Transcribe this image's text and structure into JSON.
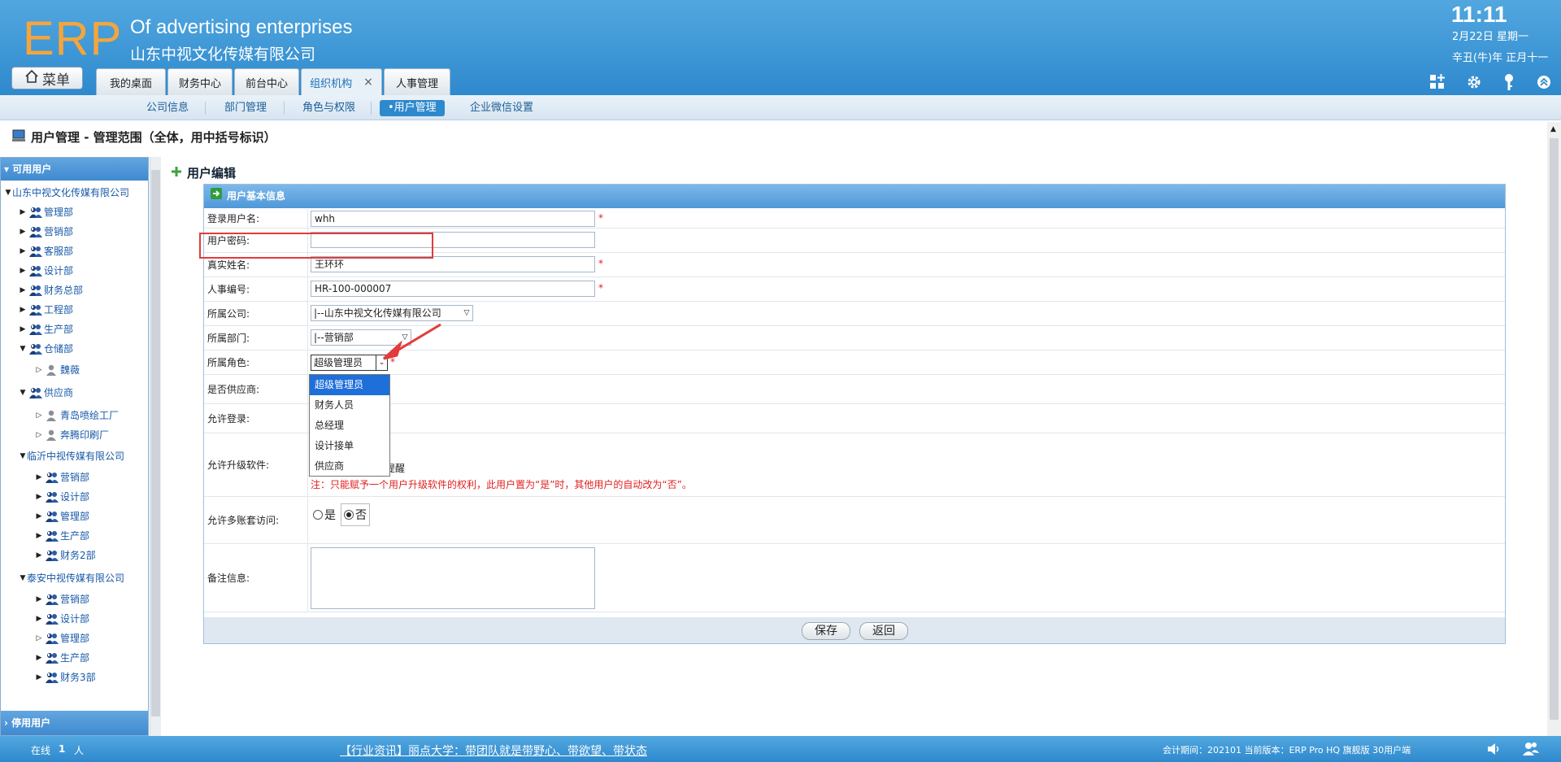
{
  "header": {
    "logo": "ERP",
    "brand_en": "Of advertising enterprises",
    "brand_cn": "山东中视文化传媒有限公司",
    "time": "11:11",
    "date1": "2月22日 星期一",
    "date2": "辛丑(牛)年 正月十一",
    "menu_label": "菜单",
    "tabs": [
      {
        "label": "我的桌面"
      },
      {
        "label": "财务中心"
      },
      {
        "label": "前台中心"
      },
      {
        "label": "组织机构"
      },
      {
        "label": "人事管理"
      }
    ],
    "tab_close": "×"
  },
  "subnav": {
    "items": [
      "公司信息",
      "部门管理",
      "角色与权限",
      "•用户管理",
      "企业微信设置"
    ]
  },
  "page_title": "用户管理 - 管理范围（全体，用中括号标识）",
  "sidebar": {
    "header": "可用用户",
    "footer": "停用用户",
    "tree": [
      {
        "label": "山东中视文化传媒有限公司"
      },
      {
        "label": "管理部"
      },
      {
        "label": "营销部"
      },
      {
        "label": "客服部"
      },
      {
        "label": "设计部"
      },
      {
        "label": "财务总部"
      },
      {
        "label": "工程部"
      },
      {
        "label": "生产部"
      },
      {
        "label": "仓储部"
      },
      {
        "label": "魏薇"
      },
      {
        "label": "供应商"
      },
      {
        "label": "青岛喷绘工厂"
      },
      {
        "label": "奔腾印刷厂"
      },
      {
        "label": "临沂中视传媒有限公司"
      },
      {
        "label": "营销部"
      },
      {
        "label": "设计部"
      },
      {
        "label": "管理部"
      },
      {
        "label": "生产部"
      },
      {
        "label": "财务2部"
      },
      {
        "label": "泰安中视传媒有限公司"
      },
      {
        "label": "营销部"
      },
      {
        "label": "设计部"
      },
      {
        "label": "管理部"
      },
      {
        "label": "生产部"
      },
      {
        "label": "财务3部"
      }
    ]
  },
  "main": {
    "title": "用户编辑",
    "section": "用户基本信息",
    "labels": {
      "username": "登录用户名:",
      "password": "用户密码:",
      "realname": "真实姓名:",
      "empno": "人事编号:",
      "company": "所属公司:",
      "dept": "所属部门:",
      "role": "所属角色:",
      "supplier": "是否供应商:",
      "login": "允许登录:",
      "upgrade": "允许升级软件:",
      "multi": "允许多账套访问:",
      "remark": "备注信息:"
    },
    "values": {
      "username": "whh",
      "password": "",
      "realname": "王环环",
      "empno": "HR-100-000007",
      "company": "|--山东中视文化传媒有限公司",
      "dept": "|--营销部",
      "role": "超级管理员"
    },
    "required_mark": "*",
    "upgrade_hint": "提醒",
    "upgrade_note": "注：只能赋予一个用户升级软件的权利，此用户置为“是”时，其他用户的自动改为“否”。",
    "radio_yes": "是",
    "radio_no": "否",
    "save": "保存",
    "back": "返回"
  },
  "role_options": [
    "超级管理员",
    "财务人员",
    "总经理",
    "设计接单",
    "供应商"
  ],
  "footer": {
    "online_label": "在线",
    "online_count": "1",
    "online_unit": "人",
    "news": "【行业资讯】丽点大学：带团队就是带野心、带欲望、带状态",
    "status": "会计期间：202101 当前版本：ERP Pro HQ 旗舰版 30用户端"
  },
  "colors": {
    "accent": "#2e89cd",
    "logo": "#f5a53c",
    "required": "#e02020",
    "highlight": "#e23b3b"
  }
}
